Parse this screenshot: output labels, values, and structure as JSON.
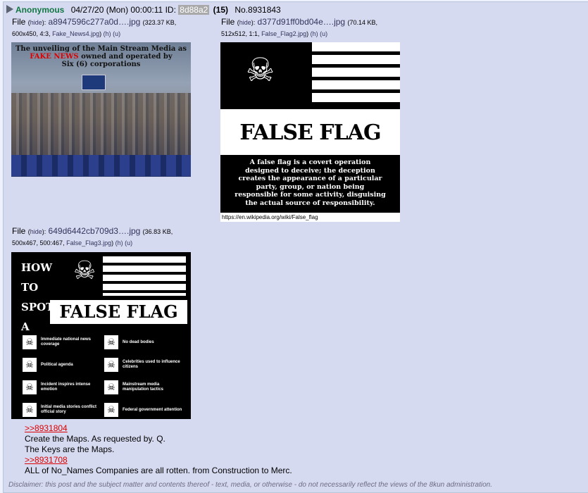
{
  "post": {
    "name": "Anonymous",
    "datetime": "04/27/20 (Mon) 00:00:11",
    "id_label": "ID:",
    "id_value": "8d88a2",
    "reply_count": "(15)",
    "number": "No.8931843",
    "collapse_icon": "triangle-right-icon"
  },
  "files": [
    {
      "file_label": "File",
      "hide_label": "hide",
      "filename": "a8947596c277a0d….jpg",
      "size": "(323.37 KB,",
      "dims": "600x450, 4:3,",
      "orig_name": "Fake_News4.jpg",
      "h_label": "(h)",
      "u_label": "(u)",
      "thumb": {
        "line1": "The unveiling of the Main Stream Media as",
        "fake": "FAKE NEWS",
        "line2": "owned and operated by",
        "line3": "Six (6) corporations"
      }
    },
    {
      "file_label": "File",
      "hide_label": "hide",
      "filename": "d377d91ff0bd04e….jpg",
      "size": "(70.14 KB,",
      "dims": "512x512, 1:1,",
      "orig_name": "False_Flag2.jpg",
      "h_label": "(h)",
      "u_label": "(u)",
      "thumb": {
        "title": "FALSE FLAG",
        "desc": "A false flag is a covert operation designed to deceive; the deception creates the appearance of a particular party, group, or nation being responsible for some activity, disguising the actual source of responsibility.",
        "source": "https://en.wikipedia.org/wiki/False_flag"
      }
    },
    {
      "file_label": "File",
      "hide_label": "hide",
      "filename": "649d6442cb709d3….jpg",
      "size": "(36.83 KB,",
      "dims": "500x467, 500:467,",
      "orig_name": "False_Flag3.jpg",
      "h_label": "(h)",
      "u_label": "(u)",
      "thumb": {
        "how1": "HOW",
        "how2": "TO",
        "how3": "SPOT",
        "how4": "A",
        "title": "FALSE FLAG",
        "items": [
          "Immediate national news coverage",
          "No dead bodies",
          "Political agenda",
          "Celebrities used to influence citizens",
          "Incident inspires intense emotion",
          "Mainstream media manipulation tactics",
          "Initial media stories conflict official story",
          "Federal government attention"
        ]
      }
    }
  ],
  "body": {
    "quote1": ">>8931804",
    "line1": "Create the Maps. As requested by. Q.",
    "line2": "The Keys are the Maps.",
    "quote2": ">>8931708",
    "line3": "ALL of No_Names Companies are all rotten. from Construction to Merc."
  },
  "disclaimer": "Disclaimer: this post and the subject matter and contents thereof - text, media, or otherwise - do not necessarily reflect the views of the 8kun administration."
}
